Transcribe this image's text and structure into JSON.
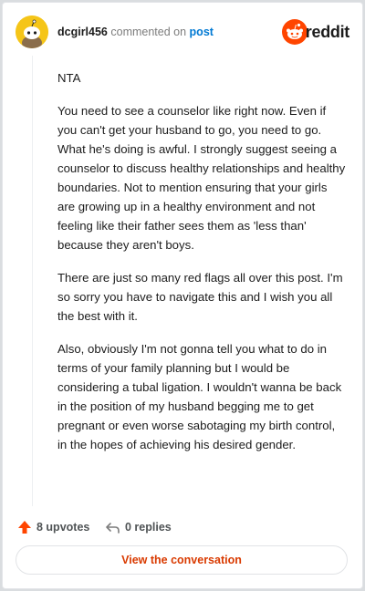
{
  "comment": {
    "username": "dcgirl456",
    "action_text": "commented on",
    "link_text": "post",
    "paragraphs": [
      "NTA",
      "You need to see a counselor like right now. Even if you can't get your husband to go, you need to go. What he's doing is awful. I strongly suggest seeing a counselor to discuss healthy relationships and healthy boundaries. Not to mention ensuring that your girls are growing up in a healthy environment and not feeling like their father sees them as 'less than' because they aren't boys.",
      "There are just so many red flags all over this post. I'm so sorry you have to navigate this and I wish you all the best with it.",
      "Also, obviously I'm not gonna tell you what to do in terms of your family planning but I would be considering a tubal ligation. I wouldn't wanna be back in the position of my husband begging me to get pregnant or even worse sabotaging my birth control, in the hopes of achieving his desired gender."
    ]
  },
  "brand": {
    "wordmark": "reddit",
    "icon": "reddit-snoo-icon"
  },
  "avatar": {
    "icon": "snoo-avatar-icon"
  },
  "footer": {
    "upvotes": "8 upvotes",
    "replies": "0 replies",
    "upvote_icon": "upvote-arrow-icon",
    "reply_icon": "reply-arrow-icon"
  },
  "action_button": {
    "label": "View the conversation"
  },
  "colors": {
    "accent": "#d93a00",
    "reddit_orange": "#ff4500",
    "link_blue": "#0079d3",
    "avatar_yellow": "#f5c518",
    "upvote": "#ff4500"
  }
}
